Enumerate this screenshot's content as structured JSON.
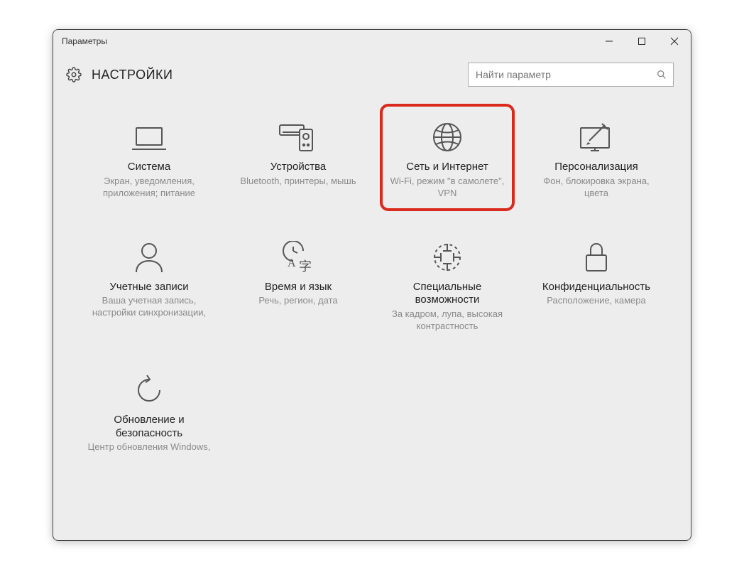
{
  "window": {
    "title": "Параметры"
  },
  "header": {
    "title": "НАСТРОЙКИ"
  },
  "search": {
    "placeholder": "Найти параметр"
  },
  "tiles": [
    {
      "title": "Система",
      "desc": "Экран, уведомления, приложения; питание"
    },
    {
      "title": "Устройства",
      "desc": "Bluetooth, принтеры, мышь"
    },
    {
      "title": "Сеть и Интернет",
      "desc": "Wi-Fi, режим \"в самолете\", VPN"
    },
    {
      "title": "Персонализация",
      "desc": "Фон, блокировка экрана, цвета"
    },
    {
      "title": "Учетные записи",
      "desc": "Ваша учетная запись, настройки синхронизации,"
    },
    {
      "title": "Время и язык",
      "desc": "Речь, регион, дата"
    },
    {
      "title": "Специальные возможности",
      "desc": "За кадром, лупа, высокая контрастность"
    },
    {
      "title": "Конфиденциальность",
      "desc": "Расположение, камера"
    },
    {
      "title": "Обновление и безопасность",
      "desc": "Центр обновления Windows,"
    }
  ]
}
